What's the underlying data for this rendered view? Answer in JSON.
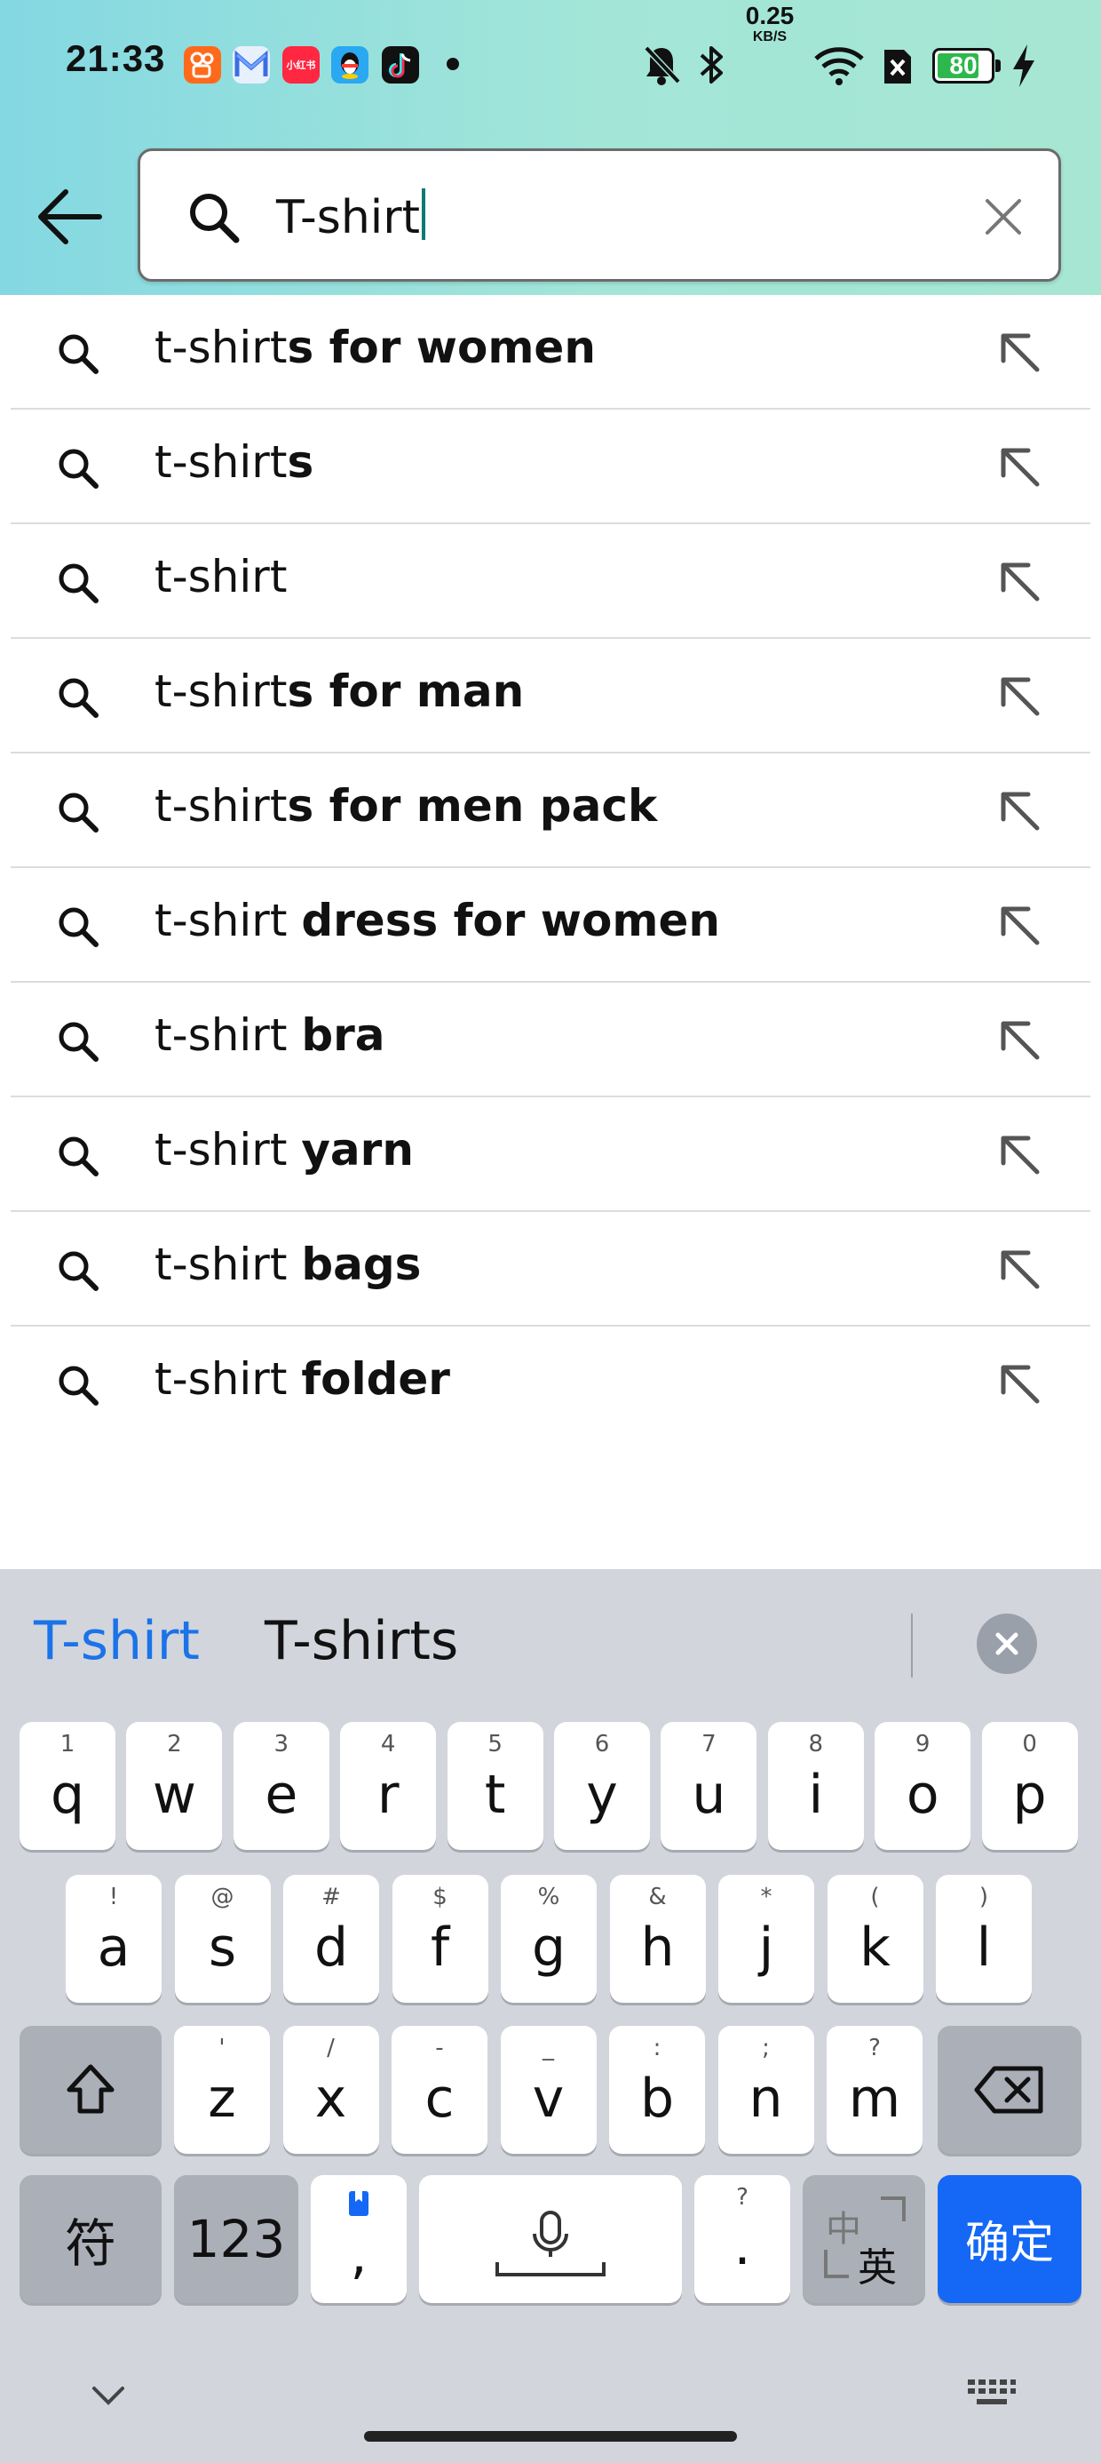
{
  "status_bar": {
    "time": "21:33",
    "apps": [
      {
        "name": "kuaishou-app-icon",
        "color": "#ff6a1a",
        "label": ""
      },
      {
        "name": "gmail-app-icon",
        "color": "#e8f0fe",
        "label": ""
      },
      {
        "name": "xiaohongshu-app-icon",
        "color": "#ff2741",
        "label": "小红书"
      },
      {
        "name": "qq-app-icon",
        "color": "#2aa8f2",
        "label": ""
      },
      {
        "name": "tiktok-app-icon",
        "color": "#111111",
        "label": ""
      }
    ],
    "net_speed_value": "0.25",
    "net_speed_unit": "KB/S",
    "battery_percent": "80",
    "battery_level": 0.8
  },
  "search": {
    "query": "T-shirt",
    "back_icon": "arrow-left-icon",
    "search_icon": "search-icon",
    "clear_icon": "close-icon"
  },
  "suggestions": [
    {
      "prefix": "t-shirt",
      "bold": "s for women"
    },
    {
      "prefix": "t-shirt",
      "bold": "s"
    },
    {
      "prefix": "t-shirt",
      "bold": ""
    },
    {
      "prefix": "t-shirt",
      "bold": "s for man"
    },
    {
      "prefix": "t-shirt",
      "bold": "s for men pack"
    },
    {
      "prefix": "t-shirt ",
      "bold": "dress for women"
    },
    {
      "prefix": "t-shirt ",
      "bold": "bra"
    },
    {
      "prefix": "t-shirt ",
      "bold": "yarn"
    },
    {
      "prefix": "t-shirt ",
      "bold": "bags"
    },
    {
      "prefix": "t-shirt ",
      "bold": "folder"
    }
  ],
  "keyboard": {
    "candidates": [
      "T-shirt",
      "T-shirts"
    ],
    "active_candidate_color": "#1a73e8",
    "row1": [
      {
        "main": "q",
        "sub": "1"
      },
      {
        "main": "w",
        "sub": "2"
      },
      {
        "main": "e",
        "sub": "3"
      },
      {
        "main": "r",
        "sub": "4"
      },
      {
        "main": "t",
        "sub": "5"
      },
      {
        "main": "y",
        "sub": "6"
      },
      {
        "main": "u",
        "sub": "7"
      },
      {
        "main": "i",
        "sub": "8"
      },
      {
        "main": "o",
        "sub": "9"
      },
      {
        "main": "p",
        "sub": "0"
      }
    ],
    "row2": [
      {
        "main": "a",
        "sub": "!"
      },
      {
        "main": "s",
        "sub": "@"
      },
      {
        "main": "d",
        "sub": "#"
      },
      {
        "main": "f",
        "sub": "$"
      },
      {
        "main": "g",
        "sub": "%"
      },
      {
        "main": "h",
        "sub": "&"
      },
      {
        "main": "j",
        "sub": "*"
      },
      {
        "main": "k",
        "sub": "("
      },
      {
        "main": "l",
        "sub": ")"
      }
    ],
    "row3": [
      {
        "main": "z",
        "sub": "'"
      },
      {
        "main": "x",
        "sub": "/"
      },
      {
        "main": "c",
        "sub": "-"
      },
      {
        "main": "v",
        "sub": "_"
      },
      {
        "main": "b",
        "sub": ":"
      },
      {
        "main": "n",
        "sub": ";"
      },
      {
        "main": "m",
        "sub": "?"
      }
    ],
    "symbol_key": "符",
    "numbers_key": "123",
    "comma_key": ",",
    "period_key": ".",
    "period_sub": "?",
    "lang_key_top": "中",
    "lang_key_bottom": "英",
    "confirm_key": "确定",
    "confirm_color": "#1468f5"
  }
}
